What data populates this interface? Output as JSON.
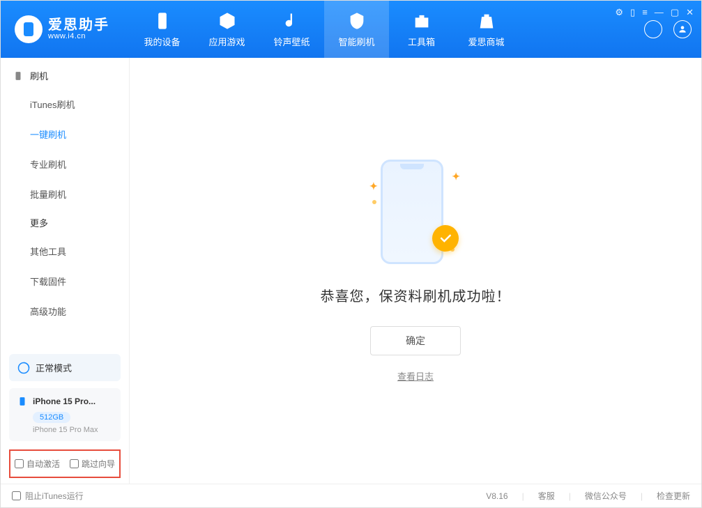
{
  "app": {
    "name": "爱思助手",
    "url": "www.i4.cn"
  },
  "tabs": [
    {
      "label": "我的设备"
    },
    {
      "label": "应用游戏"
    },
    {
      "label": "铃声壁纸"
    },
    {
      "label": "智能刷机"
    },
    {
      "label": "工具箱"
    },
    {
      "label": "爱思商城"
    }
  ],
  "sidebar": {
    "group1": "刷机",
    "items1": [
      "iTunes刷机",
      "一键刷机",
      "专业刷机",
      "批量刷机"
    ],
    "group2": "更多",
    "items2": [
      "其他工具",
      "下载固件",
      "高级功能"
    ]
  },
  "status": {
    "label": "正常模式"
  },
  "device": {
    "name": "iPhone 15 Pro...",
    "storage": "512GB",
    "full_name": "iPhone 15 Pro Max"
  },
  "checks": {
    "auto_activate": "自动激活",
    "skip_guide": "跳过向导"
  },
  "main": {
    "success_text": "恭喜您，保资料刷机成功啦！",
    "confirm": "确定",
    "log_link": "查看日志"
  },
  "footer": {
    "block_itunes": "阻止iTunes运行",
    "version": "V8.16",
    "service": "客服",
    "wechat": "微信公众号",
    "update": "检查更新"
  }
}
